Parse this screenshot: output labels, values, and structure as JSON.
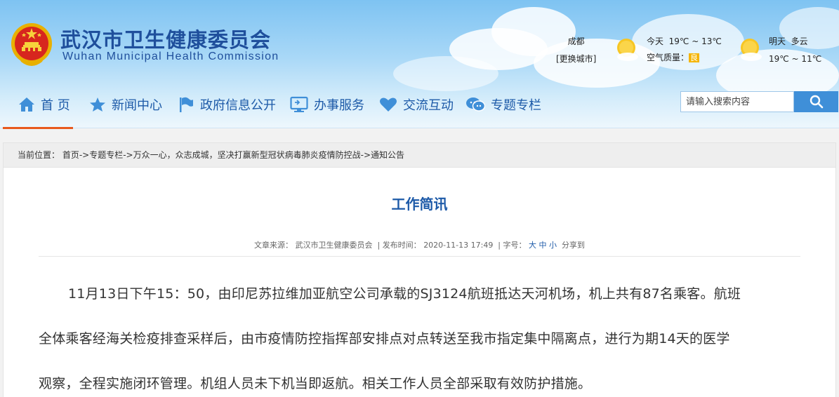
{
  "header": {
    "title_cn": "武汉市卫生健康委员会",
    "title_en": "Wuhan Municipal Health Commission"
  },
  "weather": {
    "city": "成都",
    "change_city": "[更换城市]",
    "today_label": "今天",
    "today_temp": "19℃ ~ 13℃",
    "aqi_label": "空气质量：",
    "aqi_value": "良",
    "tomorrow_label": "明天",
    "tomorrow_condition": "多云",
    "tomorrow_temp": "19℃ ~ 11℃"
  },
  "nav": {
    "items": [
      {
        "label": "首 页"
      },
      {
        "label": "新闻中心"
      },
      {
        "label": "政府信息公开"
      },
      {
        "label": "办事服务"
      },
      {
        "label": "交流互动"
      },
      {
        "label": "专题专栏"
      }
    ]
  },
  "search": {
    "placeholder": "请输入搜索内容"
  },
  "breadcrumb": {
    "prefix": "当前位置：",
    "path": "首页->专题专栏->万众一心，众志成城，坚决打赢新型冠状病毒肺炎疫情防控战->通知公告"
  },
  "article": {
    "title": "工作简讯",
    "source_label": "文章来源：",
    "source": "武汉市卫生健康委员会",
    "date_label": "发布时间：",
    "date": "2020-11-13 17:49",
    "font_label": "字号：",
    "font_large": "大",
    "font_medium": "中",
    "font_small": "小",
    "share_label": "分享到",
    "lines": [
      "11月13日下午15：50，由印尼苏拉维加亚航空公司承载的SJ3124航班抵达天河机场，机上共有87名乘客。航班",
      "全体乘客经海关检疫排查采样后，由市疫情防控指挥部安排点对点转送至我市指定集中隔离点，进行为期14天的医学",
      "观察，全程实施闭环管理。机组人员未下机当即返航。相关工作人员全部采取有效防护措施。"
    ]
  },
  "colors": {
    "brand_blue": "#1d5aa8",
    "nav_active": "#e85a1e",
    "search_button": "#3f8fd8"
  }
}
